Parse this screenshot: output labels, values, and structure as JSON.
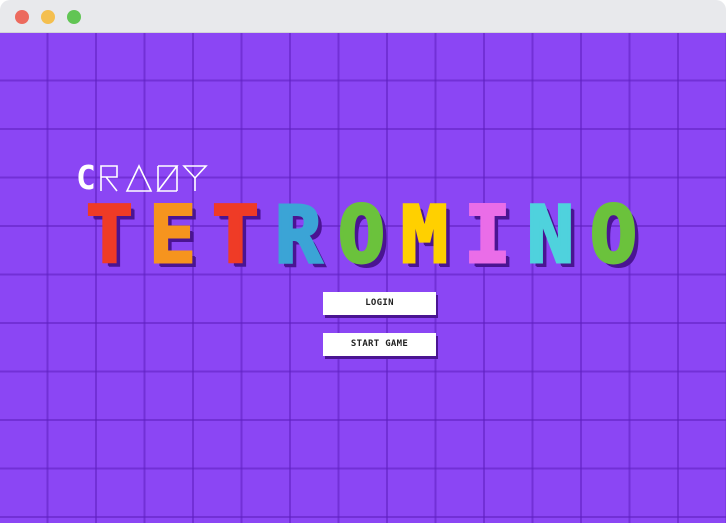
{
  "window": {
    "controls": [
      {
        "name": "close",
        "color": "#ec6a5e"
      },
      {
        "name": "minimize",
        "color": "#f4bf4f"
      },
      {
        "name": "zoom",
        "color": "#61c554"
      }
    ]
  },
  "game": {
    "background_color": "#8b46f4",
    "grid_color": "#5c1ebe",
    "title_small": {
      "first_letter": "C",
      "outline_letters": "RAZY",
      "full": "CRAZY"
    },
    "title_big": [
      {
        "char": "T",
        "color": "#ef3b26"
      },
      {
        "char": "E",
        "color": "#f6941e"
      },
      {
        "char": "T",
        "color": "#ef3b26"
      },
      {
        "char": "R",
        "color": "#3ba4d6"
      },
      {
        "char": "O",
        "color": "#6bc23c"
      },
      {
        "char": "M",
        "color": "#ffd000"
      },
      {
        "char": "I",
        "color": "#ea6de8"
      },
      {
        "char": "N",
        "color": "#4fd2dd"
      },
      {
        "char": "O",
        "color": "#6bc23c"
      }
    ],
    "menu": {
      "login_label": "LOGIN",
      "start_label": "START GAME"
    }
  }
}
